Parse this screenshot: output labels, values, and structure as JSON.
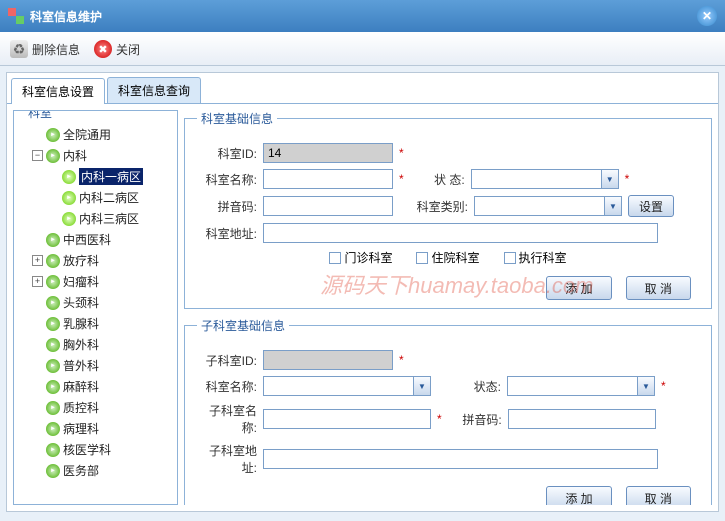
{
  "window": {
    "title": "科室信息维护"
  },
  "toolbar": {
    "delete": "删除信息",
    "close": "关闭"
  },
  "tabs": [
    {
      "label": "科室信息设置",
      "active": true
    },
    {
      "label": "科室信息查询",
      "active": false
    }
  ],
  "tree": {
    "legend": "科室",
    "nodes": [
      {
        "label": "全院通用",
        "level": 1,
        "toggle": ""
      },
      {
        "label": "内科",
        "level": 1,
        "toggle": "−"
      },
      {
        "label": "内科一病区",
        "level": 2,
        "selected": true
      },
      {
        "label": "内科二病区",
        "level": 2
      },
      {
        "label": "内科三病区",
        "level": 2
      },
      {
        "label": "中西医科",
        "level": 1,
        "toggle": ""
      },
      {
        "label": "放疗科",
        "level": 1,
        "toggle": "+"
      },
      {
        "label": "妇瘤科",
        "level": 1,
        "toggle": "+"
      },
      {
        "label": "头颈科",
        "level": 1,
        "toggle": ""
      },
      {
        "label": "乳腺科",
        "level": 1,
        "toggle": ""
      },
      {
        "label": "胸外科",
        "level": 1,
        "toggle": ""
      },
      {
        "label": "普外科",
        "level": 1,
        "toggle": ""
      },
      {
        "label": "麻醉科",
        "level": 1,
        "toggle": ""
      },
      {
        "label": "质控科",
        "level": 1,
        "toggle": ""
      },
      {
        "label": "病理科",
        "level": 1,
        "toggle": ""
      },
      {
        "label": "核医学科",
        "level": 1,
        "toggle": ""
      },
      {
        "label": "医务部",
        "level": 1,
        "toggle": ""
      }
    ]
  },
  "form1": {
    "legend": "科室基础信息",
    "dept_id_label": "科室ID:",
    "dept_id_value": "14",
    "dept_name_label": "科室名称:",
    "dept_name_value": "",
    "status_label": "状  态:",
    "status_value": "",
    "pinyin_label": "拼音码:",
    "pinyin_value": "",
    "category_label": "科室类别:",
    "category_value": "",
    "set_btn": "设置",
    "addr_label": "科室地址:",
    "addr_value": "",
    "chk_outpatient": "门诊科室",
    "chk_inpatient": "住院科室",
    "chk_exec": "执行科室",
    "add_btn": "添 加",
    "cancel_btn": "取 消"
  },
  "form2": {
    "legend": "子科室基础信息",
    "sub_id_label": "子科室ID:",
    "sub_id_value": "",
    "dept_name_label": "科室名称:",
    "dept_name_value": "",
    "status_label": "状态:",
    "status_value": "",
    "sub_name_label": "子科室名称:",
    "sub_name_value": "",
    "pinyin_label": "拼音码:",
    "pinyin_value": "",
    "addr_label": "子科室地址:",
    "addr_value": "",
    "add_btn": "添 加",
    "cancel_btn": "取 消"
  },
  "watermark": "源码天下huamay.taoba.com"
}
